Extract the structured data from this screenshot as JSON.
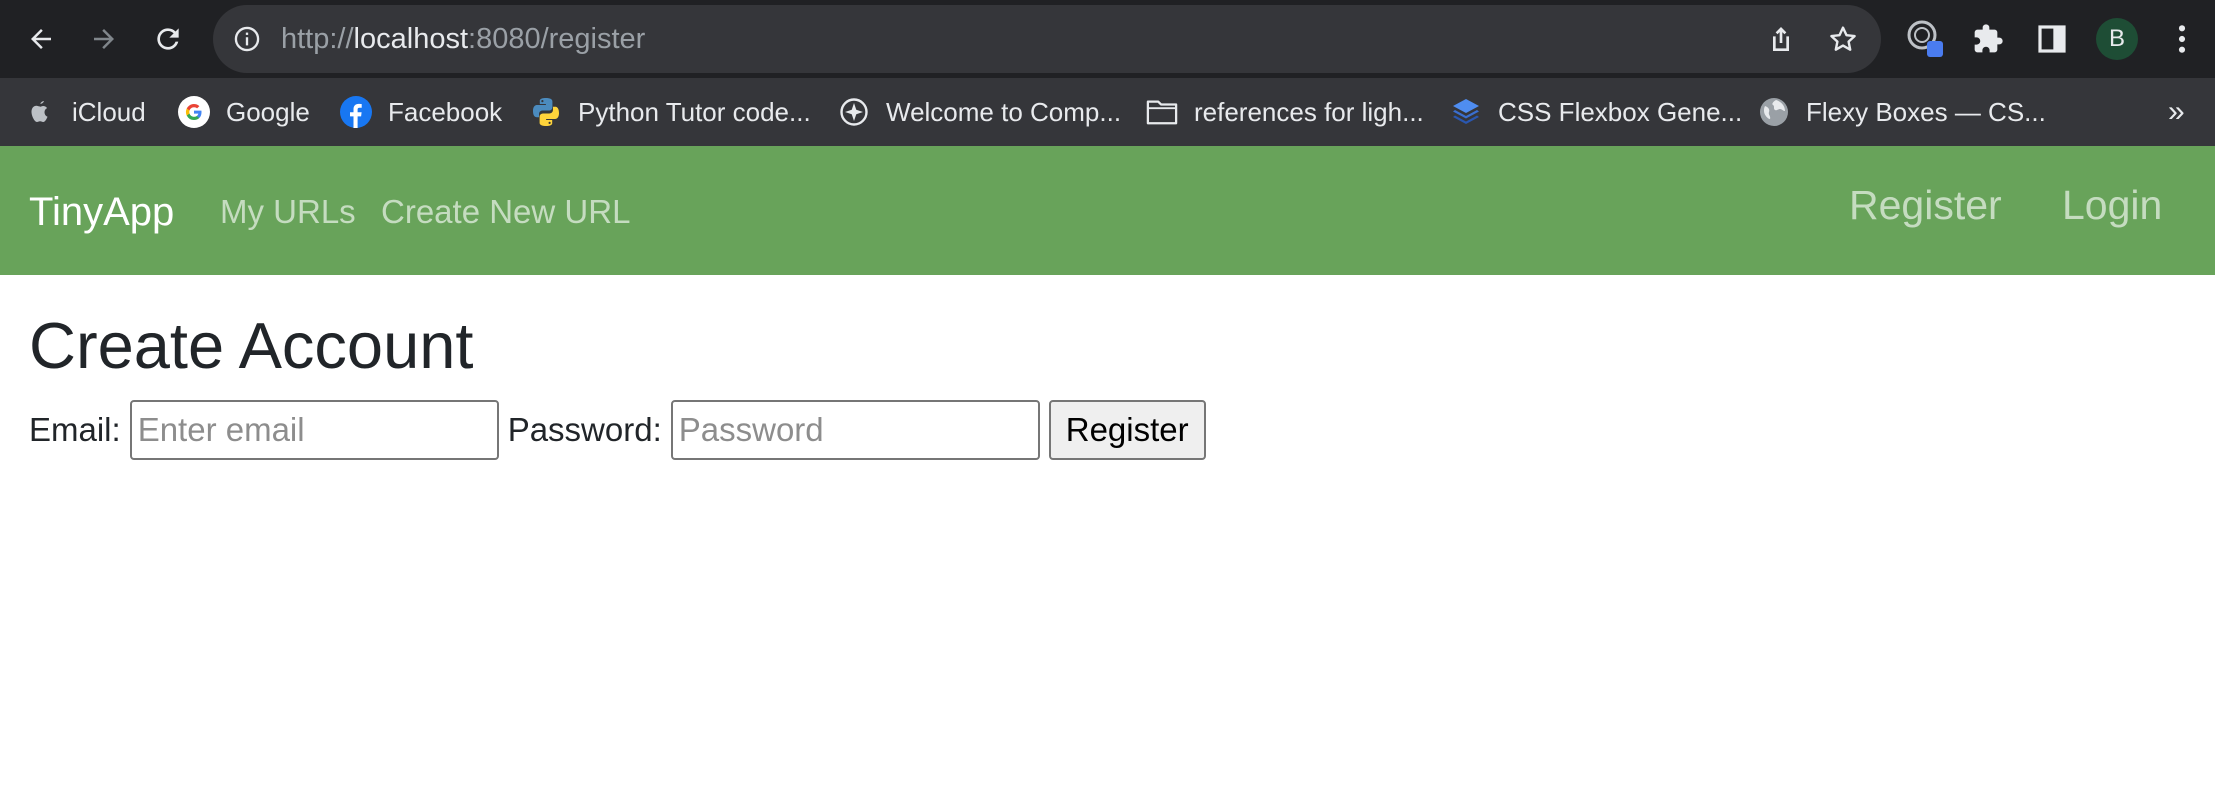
{
  "browser": {
    "url_scheme": "http://",
    "url_host": "localhost",
    "url_rest": ":8080/register",
    "profile_initial": "B",
    "bookmarks": [
      {
        "label": "iCloud",
        "icon": "apple-icon"
      },
      {
        "label": "Google",
        "icon": "google-icon"
      },
      {
        "label": "Facebook",
        "icon": "facebook-icon"
      },
      {
        "label": "Python Tutor code...",
        "icon": "python-icon"
      },
      {
        "label": "Welcome to Comp...",
        "icon": "compass-icon"
      },
      {
        "label": "references for ligh...",
        "icon": "folder-icon"
      },
      {
        "label": "CSS Flexbox Gene...",
        "icon": "css-layers-icon"
      },
      {
        "label": "Flexy Boxes — CS...",
        "icon": "globe-icon"
      }
    ],
    "bookmarks_overflow": "»"
  },
  "navbar": {
    "brand": "TinyApp",
    "links": [
      "My URLs",
      "Create New URL"
    ],
    "right_links": [
      "Register",
      "Login"
    ],
    "color": "#68a35a"
  },
  "main": {
    "title": "Create Account",
    "email_label": "Email:",
    "email_placeholder": "Enter email",
    "password_label": "Password:",
    "password_placeholder": "Password",
    "submit_label": "Register"
  }
}
